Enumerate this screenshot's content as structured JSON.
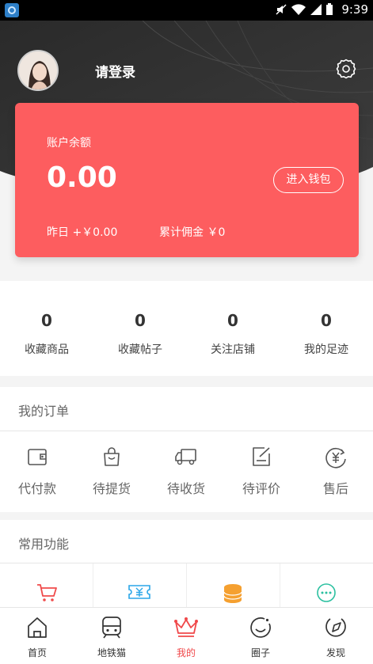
{
  "status_bar": {
    "time": "9:39"
  },
  "header": {
    "login_label": "请登录"
  },
  "balance_card": {
    "title": "账户余额",
    "amount": "0.00",
    "wallet_button": "进入钱包",
    "yesterday": "昨日 +￥0.00",
    "commission": "累计佣金 ￥0"
  },
  "stats": [
    {
      "value": "0",
      "label": "收藏商品"
    },
    {
      "value": "0",
      "label": "收藏帖子"
    },
    {
      "value": "0",
      "label": "关注店铺"
    },
    {
      "value": "0",
      "label": "我的足迹"
    }
  ],
  "orders": {
    "title": "我的订单",
    "items": [
      {
        "label": "代付款",
        "icon": "wallet-icon"
      },
      {
        "label": "待提货",
        "icon": "bag-icon"
      },
      {
        "label": "待收货",
        "icon": "truck-icon"
      },
      {
        "label": "待评价",
        "icon": "edit-icon"
      },
      {
        "label": "售后",
        "icon": "refund-icon"
      }
    ]
  },
  "functions": {
    "title": "常用功能",
    "icons": [
      {
        "icon": "cart-icon",
        "color": "#f04b4b"
      },
      {
        "icon": "coupon-icon",
        "color": "#2aa6e8"
      },
      {
        "icon": "coins-icon",
        "color": "#f5a030"
      },
      {
        "icon": "chat-icon",
        "color": "#2bc0a0"
      }
    ]
  },
  "tabbar": {
    "active_color": "#f0484a",
    "items": [
      {
        "label": "首页",
        "icon": "home-icon"
      },
      {
        "label": "地铁猫",
        "icon": "metro-icon"
      },
      {
        "label": "我的",
        "icon": "crown-icon",
        "active": true
      },
      {
        "label": "圈子",
        "icon": "circle-smile-icon"
      },
      {
        "label": "发现",
        "icon": "compass-icon"
      }
    ]
  }
}
